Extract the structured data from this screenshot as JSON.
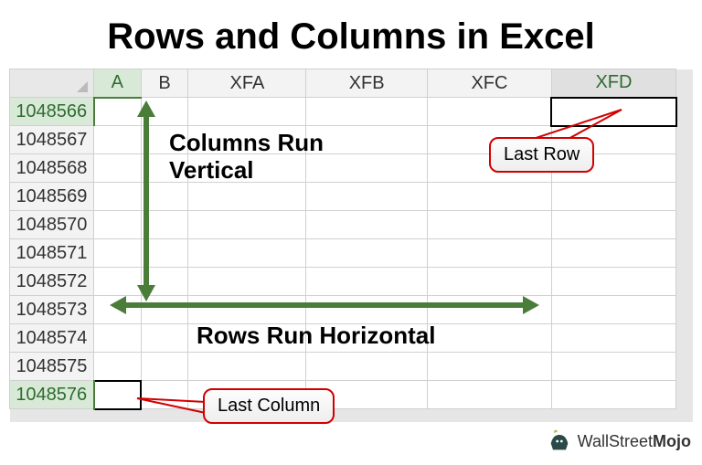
{
  "title": "Rows and Columns in Excel",
  "columns": [
    "A",
    "B",
    "XFA",
    "XFB",
    "XFC",
    "XFD"
  ],
  "rows": [
    "1048566",
    "1048567",
    "1048568",
    "1048569",
    "1048570",
    "1048571",
    "1048572",
    "1048573",
    "1048574",
    "1048575",
    "1048576"
  ],
  "labels": {
    "columns_run": "Columns Run",
    "vertical": "Vertical",
    "rows_run": "Rows Run Horizontal"
  },
  "callouts": {
    "last_row": "Last Row",
    "last_column": "Last Column"
  },
  "logo": {
    "part1": "WallStreet",
    "part2": "Mojo"
  },
  "colors": {
    "arrow": "#4a7c3a",
    "callout_border": "#d20000"
  }
}
